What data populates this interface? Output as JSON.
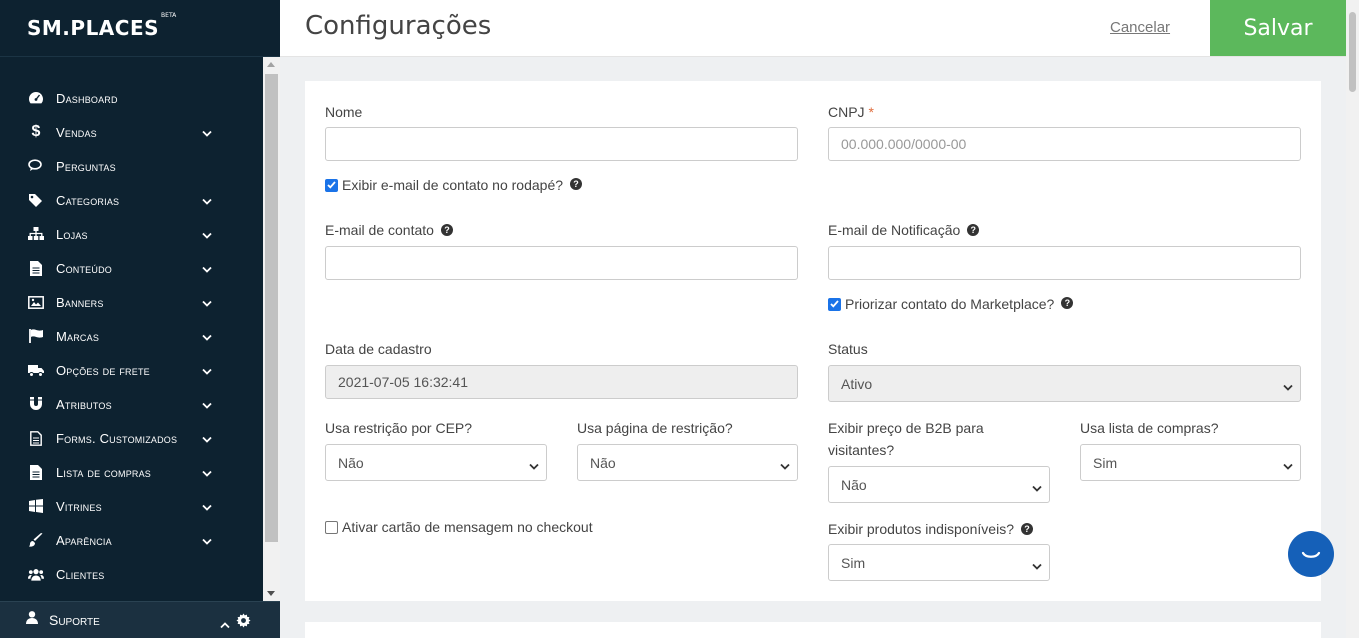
{
  "sidebar": {
    "logo": "SM.PLACES",
    "logo_badge": "BETA",
    "items": [
      {
        "label": "Dashboard",
        "icon": "dashboard-icon",
        "expandable": false
      },
      {
        "label": "Vendas",
        "icon": "dollar-icon",
        "expandable": true
      },
      {
        "label": "Perguntas",
        "icon": "comments-icon",
        "expandable": false
      },
      {
        "label": "Categorias",
        "icon": "tags-icon",
        "expandable": true
      },
      {
        "label": "Lojas",
        "icon": "sitemap-icon",
        "expandable": true
      },
      {
        "label": "Conteúdo",
        "icon": "file-icon",
        "expandable": true
      },
      {
        "label": "Banners",
        "icon": "image-icon",
        "expandable": true
      },
      {
        "label": "Marcas",
        "icon": "flag-icon",
        "expandable": true
      },
      {
        "label": "Opções de frete",
        "icon": "truck-icon",
        "expandable": true
      },
      {
        "label": "Atributos",
        "icon": "magnet-icon",
        "expandable": true
      },
      {
        "label": "Forms. Customizados",
        "icon": "form-icon",
        "expandable": true
      },
      {
        "label": "Lista de compras",
        "icon": "list-file-icon",
        "expandable": true
      },
      {
        "label": "Vitrines",
        "icon": "windows-icon",
        "expandable": true
      },
      {
        "label": "Aparência",
        "icon": "brush-icon",
        "expandable": true
      },
      {
        "label": "Clientes",
        "icon": "users-icon",
        "expandable": false
      }
    ],
    "support_label": "Suporte"
  },
  "header": {
    "title": "Configurações",
    "cancel_label": "Cancelar",
    "save_label": "Salvar"
  },
  "form": {
    "nome_label": "Nome",
    "nome_value": "",
    "cnpj_label": "CNPJ",
    "cnpj_required": "*",
    "cnpj_placeholder": "00.000.000/0000-00",
    "show_email_footer_label": "Exibir e-mail de contato no rodapé?",
    "show_email_footer_checked": true,
    "email_contato_label": "E-mail de contato",
    "email_contato_value": "",
    "email_notificacao_label": "E-mail de Notificação",
    "email_notificacao_value": "",
    "priorizar_label": "Priorizar contato do Marketplace?",
    "priorizar_checked": true,
    "data_cadastro_label": "Data de cadastro",
    "data_cadastro_value": "2021-07-05 16:32:41",
    "status_label": "Status",
    "status_value": "Ativo",
    "cep_label": "Usa restrição por CEP?",
    "cep_value": "Não",
    "pagina_restricao_label": "Usa página de restrição?",
    "pagina_restricao_value": "Não",
    "b2b_label_line1": "Exibir preço de B2B para",
    "b2b_label_line2": "visitantes?",
    "b2b_value": "Não",
    "lista_compras_label": "Usa lista de compras?",
    "lista_compras_value": "Sim",
    "cartao_label": "Ativar cartão de mensagem no checkout",
    "cartao_checked": false,
    "indisponiveis_label": "Exibir produtos indisponíveis?",
    "indisponiveis_value": "Sim",
    "help_glyph": "?"
  },
  "colors": {
    "sidebar_bg": "#0d2230",
    "save_bg": "#5cb85c",
    "chat_bg": "#1560b8",
    "checkbox": "#1a73e8"
  }
}
